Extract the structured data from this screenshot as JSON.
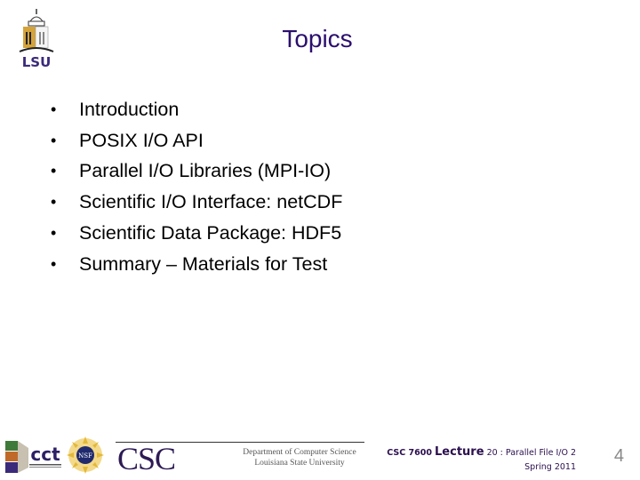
{
  "slide": {
    "title": "Topics",
    "bullets": [
      "Introduction",
      "POSIX I/O API",
      "Parallel I/O Libraries (MPI-IO)",
      "Scientific I/O Interface: netCDF",
      "Scientific Data Package: HDF5",
      "Summary – Materials for Test"
    ],
    "bullet_glyph": "•"
  },
  "header": {
    "logo_text": "LSU"
  },
  "footer": {
    "csc_logo_text": "CSC",
    "dept_line1": "Department of Computer Science",
    "dept_line2": "Louisiana State University",
    "nsf_text": "NSF",
    "cct_text": "cct",
    "course_code": "CSC 7600",
    "lecture_word": "Lecture",
    "lecture_rest": "20 : Parallel File I/O 2",
    "term": "Spring 2011",
    "page_number": "4"
  },
  "colors": {
    "title": "#2b0f6e",
    "lsu_purple": "#3b2a7a",
    "lsu_gold": "#d4a33a"
  }
}
